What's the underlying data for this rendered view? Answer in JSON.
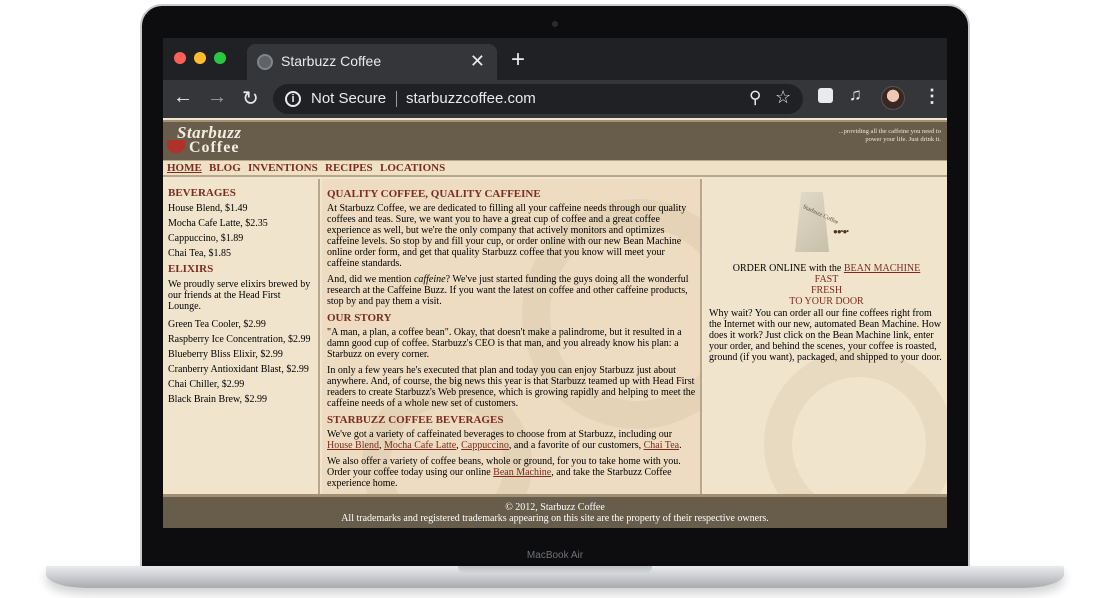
{
  "device": {
    "brand": "MacBook Air"
  },
  "browser": {
    "tab_title": "Starbuzz Coffee",
    "close_glyph": "✕",
    "new_tab_glyph": "+",
    "security_label": "Not Secure",
    "url": "starbuzzcoffee.com",
    "icons": [
      "back-icon",
      "forward-icon",
      "reload-icon",
      "info-icon",
      "zoom-icon",
      "star-icon",
      "extensions-icon",
      "media-icon",
      "profile-avatar",
      "menu-icon"
    ]
  },
  "site": {
    "logo_line1": "Starbuzz",
    "logo_line2": "Coffee",
    "tagline": "...providing all the caffeine you need to power your life. Just drink it.",
    "nav": [
      "HOME",
      "BLOG",
      "INVENTIONS",
      "RECIPES",
      "LOCATIONS"
    ],
    "left": {
      "beverages_heading": "BEVERAGES",
      "beverages": [
        "House Blend, $1.49",
        "Mocha Cafe Latte, $2.35",
        "Cappuccino, $1.89",
        "Chai Tea, $1.85"
      ],
      "elixirs_heading": "ELIXIRS",
      "elixirs_intro": "We proudly serve elixirs brewed by our friends at the Head First Lounge.",
      "elixirs": [
        "Green Tea Cooler, $2.99",
        "Raspberry Ice Concentration, $2.99",
        "Blueberry Bliss Elixir, $2.99",
        "Cranberry Antioxidant Blast, $2.99",
        "Chai Chiller, $2.99",
        "Black Brain Brew, $2.99"
      ]
    },
    "main": {
      "h1": "QUALITY COFFEE, QUALITY CAFFEINE",
      "p1": "At Starbuzz Coffee, we are dedicated to filling all your caffeine needs through our quality coffees and teas. Sure, we want you to have a great cup of coffee and a great coffee experience as well, but we're the only company that actively monitors and optimizes caffeine levels. So stop by and fill your cup, or order online with our new Bean Machine online order form, and get that quality Starbuzz coffee that you know will meet your caffeine standards.",
      "p2a": "And, did we mention ",
      "p2em": "caffeine",
      "p2b": "? We've just started funding the guys doing all the wonderful research at the Caffeine Buzz. If you want the latest on coffee and other caffeine products, stop by and pay them a visit.",
      "h2": "OUR STORY",
      "p3": "\"A man, a plan, a coffee bean\". Okay, that doesn't make a palindrome, but it resulted in a damn good cup of coffee. Starbuzz's CEO is that man, and you already know his plan: a Starbuzz on every corner.",
      "p4": "In only a few years he's executed that plan and today you can enjoy Starbuzz just about anywhere. And, of course, the big news this year is that Starbuzz teamed up with Head First readers to create Starbuzz's Web presence, which is growing rapidly and helping to meet the caffeine needs of a whole new set of customers.",
      "h3": "STARBUZZ COFFEE BEVERAGES",
      "p5_pre": "We've got a variety of caffeinated beverages to choose from at Starbuzz, including our ",
      "link_house": "House Blend",
      "link_mocha": "Mocha Cafe Latte",
      "link_capp": "Cappuccino",
      "p5_mid": ", and a favorite of our customers, ",
      "link_chai": "Chai Tea",
      "comma": ", ",
      "period": ".",
      "p6_pre": "We also offer a variety of coffee beans, whole or ground, for you to take home with you. Order your coffee today using our online ",
      "link_bean": "Bean Machine",
      "p6_post": ", and take the Starbuzz Coffee experience home."
    },
    "right": {
      "bag_label": "Starbuzz Coffee",
      "order_prefix": "ORDER ONLINE with the ",
      "bean_machine": "BEAN MACHINE",
      "fast": "FAST",
      "fresh": "FRESH",
      "to_your_door": "TO YOUR DOOR",
      "paragraph": "Why wait? You can order all our fine coffees right from the Internet with our new, automated Bean Machine. How does it work? Just click on the Bean Machine link, enter your order, and behind the scenes, your coffee is roasted, ground (if you want), packaged, and shipped to your door."
    },
    "footer": {
      "copyright": "© 2012, Starbuzz Coffee",
      "trademarks": "All trademarks and registered trademarks appearing on this site are the property of their respective owners."
    }
  }
}
